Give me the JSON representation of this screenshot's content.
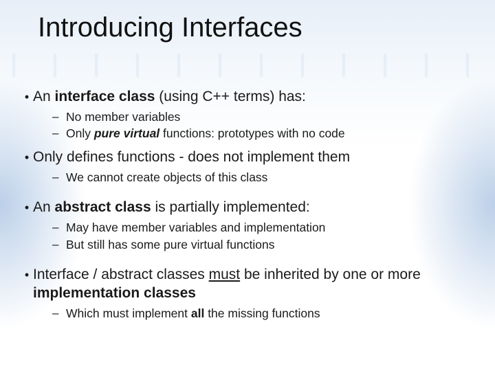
{
  "title": "Introducing Interfaces",
  "bullets": {
    "b1": {
      "pre": "An ",
      "bold": "interface class",
      "post": " (using C++ terms) has:"
    },
    "b1s": {
      "a": "No member variables",
      "b": {
        "pre": "Only ",
        "boldItal": "pure virtual",
        "post": " functions: prototypes with no code"
      }
    },
    "b2": "Only defines functions - does not implement them",
    "b2s": {
      "a": "We cannot create objects of this class"
    },
    "b3": {
      "pre": "An ",
      "bold": "abstract class",
      "post": " is partially implemented:"
    },
    "b3s": {
      "a": "May have member variables and implementation",
      "b": "But still has some pure virtual functions"
    },
    "b4": {
      "pre": "Interface / abstract classes ",
      "ul": "must",
      "mid": " be inherited by one or more ",
      "bold": "implementation classes"
    },
    "b4s": {
      "a": {
        "pre": "Which must implement ",
        "bold": "all",
        "post": " the missing functions"
      }
    }
  }
}
